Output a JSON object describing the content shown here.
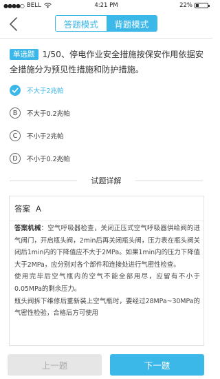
{
  "status": {
    "carrier": "BELL",
    "time": "4:21 PM",
    "battery": "22%"
  },
  "nav": {
    "back_icon": "chevron-left-icon",
    "mode_answer": "答题模式",
    "mode_recite": "背题模式",
    "active_mode": "背题模式"
  },
  "question": {
    "type_tag": "单选题",
    "text": "1/50、停电作业安全措施按保安作用依据安全措施分为预见性措施和防护措施。"
  },
  "options": [
    {
      "letter": "A",
      "text": "不大于2兆帕",
      "correct": true
    },
    {
      "letter": "B",
      "text": "不大于0.2兆帕",
      "correct": false
    },
    {
      "letter": "C",
      "text": "不小于2兆帕",
      "correct": false
    },
    {
      "letter": "D",
      "text": "不小于0.2兆帕",
      "correct": false
    }
  ],
  "detail": {
    "section_title": "试题详解",
    "answer_label": "答案",
    "answer_value": "A",
    "analysis_label": "答案机械",
    "analysis_lines": [
      "：空气呼吸器检查，关闭正压式空气呼吸器供给阀的进气阀门，开启瓶头阀，2min后再关闭瓶头阀，压力表在瓶头阀关闭后1min内的下降值应不大于2MPa。如果1min内的压力下降值大于2MPa，应分别对各个部件和连接处进行气密性检查。",
      "使用完毕后空气瓶内的空气不能全部用尽，应留有不小于0.05MPa的剩余压力。",
      "瓶头阀拆下维修后重新装上空气瓶时，要经过28MPa~30MPa的气密性检验，合格后方可使用"
    ]
  },
  "buttons": {
    "prev": "上一题",
    "next": "下一题"
  },
  "colors": {
    "accent": "#3bb7e8",
    "disabled_bg": "#e6e6e6",
    "disabled_text": "#aaaaaa"
  }
}
